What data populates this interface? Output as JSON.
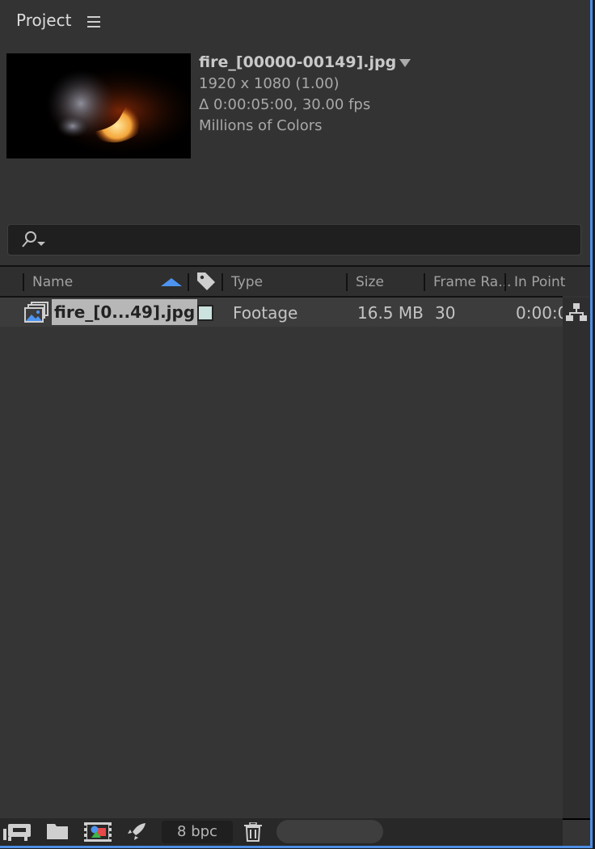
{
  "panel": {
    "title": "Project",
    "menu_icon": "hamburger-menu-icon"
  },
  "preview": {
    "file_name": "fire_[00000-00149].jpg",
    "dimensions": "1920 x 1080 (1.00)",
    "duration": "Δ 0:00:05:00, 30.00 fps",
    "color_depth": "Millions of Colors"
  },
  "search": {
    "value": "",
    "placeholder": ""
  },
  "columns": {
    "name": "Name",
    "type": "Type",
    "size": "Size",
    "frame_rate": "Frame Ra...",
    "in_point": "In Point"
  },
  "rows": [
    {
      "name": "fire_[0...49].jpg",
      "label_color": "#cbe2de",
      "type": "Footage",
      "size": "16.5 MB",
      "frame_rate": "30",
      "in_point": "0:00:0"
    }
  ],
  "footer": {
    "bpc": "8 bpc"
  },
  "colors": {
    "accent": "#4d8ee6",
    "sort_arrow": "#4d94f0"
  }
}
